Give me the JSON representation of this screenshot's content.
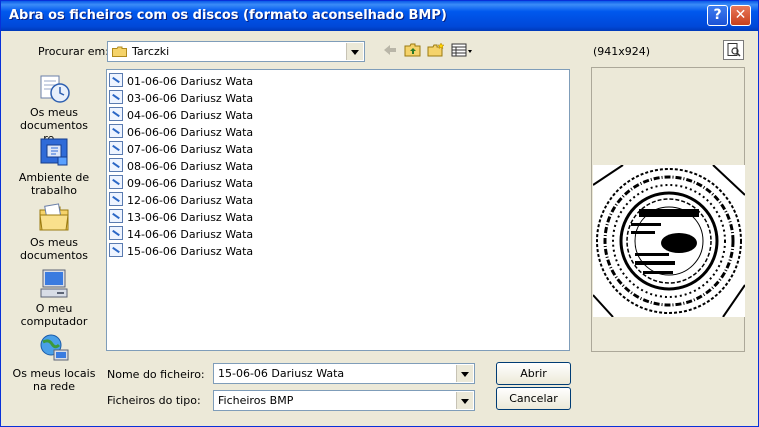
{
  "title": "Abra os ficheiros com os discos (formato aconselhado BMP)",
  "titlebar": {
    "help_glyph": "?",
    "close_glyph": "✕"
  },
  "lookin": {
    "label": "Procurar em:",
    "value": "Tarczki"
  },
  "toolbar": {
    "back_icon": "back-arrow-icon",
    "up_icon": "up-folder-icon",
    "newfolder_icon": "new-folder-icon",
    "view_icon": "view-menu-icon"
  },
  "places": [
    {
      "label": "Os meus documentos re...",
      "icon": "recent-documents-icon"
    },
    {
      "label": "Ambiente de trabalho",
      "icon": "desktop-icon"
    },
    {
      "label": "Os meus documentos",
      "icon": "my-documents-icon"
    },
    {
      "label": "O meu computador",
      "icon": "my-computer-icon"
    },
    {
      "label": "Os meus locais na rede",
      "icon": "network-places-icon"
    }
  ],
  "files": [
    "01-06-06 Dariusz Wata",
    "03-06-06 Dariusz Wata",
    "04-06-06 Dariusz Wata",
    "06-06-06 Dariusz Wata",
    "07-06-06 Dariusz Wata",
    "08-06-06 Dariusz Wata",
    "09-06-06 Dariusz Wata",
    "12-06-06 Dariusz Wata",
    "13-06-06 Dariusz Wata",
    "14-06-06 Dariusz Wata",
    "15-06-06 Dariusz Wata"
  ],
  "preview": {
    "dims": "(941x924)"
  },
  "filename": {
    "label": "Nome do ficheiro:",
    "value": "15-06-06 Dariusz Wata"
  },
  "filetype": {
    "label": "Ficheiros do tipo:",
    "value": "Ficheiros BMP"
  },
  "buttons": {
    "open": "Abrir",
    "cancel": "Cancelar"
  }
}
